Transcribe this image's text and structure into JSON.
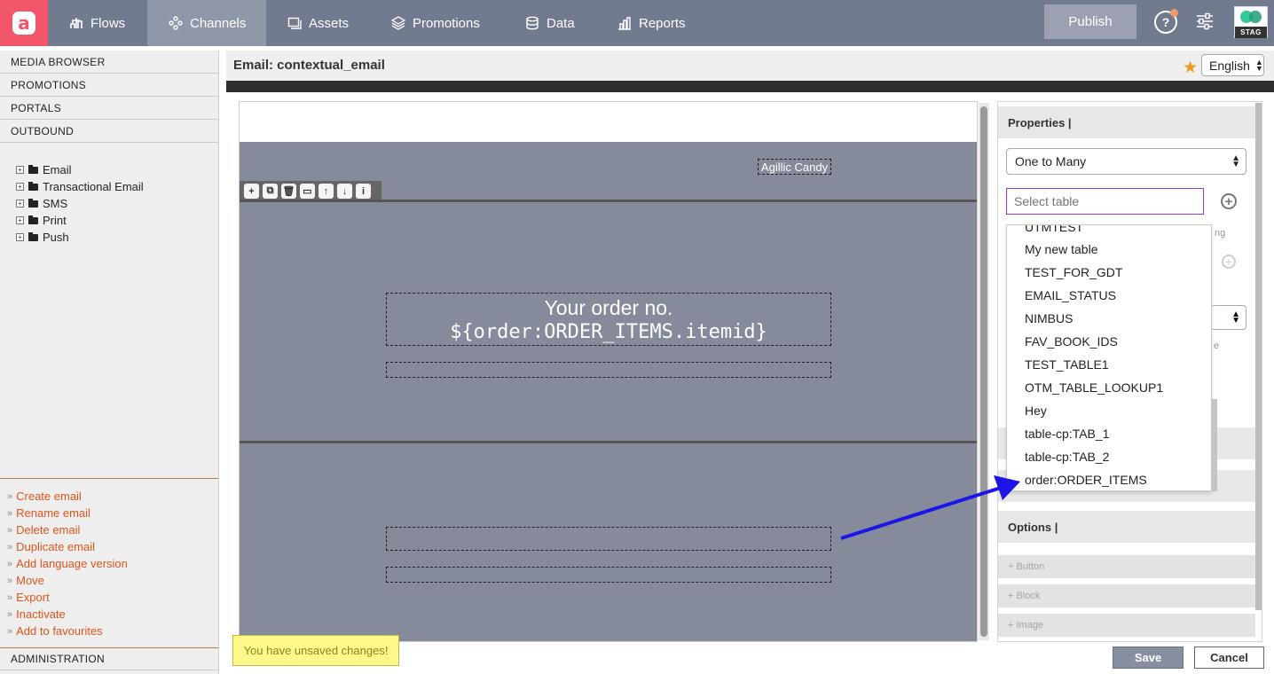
{
  "app": {
    "logo_letter": "a",
    "nav": [
      {
        "label": "Flows",
        "icon": "flows-icon",
        "active": false
      },
      {
        "label": "Channels",
        "icon": "channels-icon",
        "active": true
      },
      {
        "label": "Assets",
        "icon": "assets-icon",
        "active": false
      },
      {
        "label": "Promotions",
        "icon": "promotions-icon",
        "active": false
      },
      {
        "label": "Data",
        "icon": "data-icon",
        "active": false
      },
      {
        "label": "Reports",
        "icon": "reports-icon",
        "active": false
      }
    ],
    "publish_label": "Publish",
    "help_glyph": "?",
    "env_badge": "STAG",
    "colors": {
      "brand": "#f2566b",
      "topbar": "#727a8f",
      "accent": "#e0541a",
      "arrow": "#1d14e8"
    }
  },
  "sidebar": {
    "sections": [
      "MEDIA BROWSER",
      "PROMOTIONS",
      "PORTALS",
      "OUTBOUND"
    ],
    "tree": [
      "Email",
      "Transactional Email",
      "SMS",
      "Print",
      "Push"
    ],
    "actions": [
      "Create email",
      "Rename email",
      "Delete email",
      "Duplicate email",
      "Add language version",
      "Move",
      "Export",
      "Inactivate",
      "Add to favourites"
    ],
    "footer": "ADMINISTRATION"
  },
  "editor": {
    "title": "Email: contextual_email",
    "language": "English",
    "brand_text": "Agillic Candy",
    "order_line1": "Your order no.",
    "order_line2": "${order:ORDER_ITEMS.itemid}",
    "toolbar_icons": [
      "add-block-icon",
      "copy-block-icon",
      "delete-block-icon",
      "save-block-icon",
      "move-up-icon",
      "move-down-icon",
      "info-icon"
    ]
  },
  "properties": {
    "header": "Properties |",
    "relation": "One to Many",
    "table_placeholder": "Select table",
    "peek_text1": "ng",
    "peek_text2": "e",
    "dropdown_items": [
      "UTMTEST",
      "My new table",
      "TEST_FOR_GDT",
      "EMAIL_STATUS",
      "NIMBUS",
      "FAV_BOOK_IDS",
      "TEST_TABLE1",
      "OTM_TABLE_LOOKUP1",
      "Hey",
      "table-cp:TAB_1",
      "table-cp:TAB_2",
      "order:ORDER_ITEMS"
    ],
    "options_header": "Options |",
    "options": [
      "+ Button",
      "+ Block",
      "+ Image"
    ]
  },
  "footer": {
    "unsaved": "You have unsaved changes!",
    "save": "Save",
    "cancel": "Cancel"
  }
}
